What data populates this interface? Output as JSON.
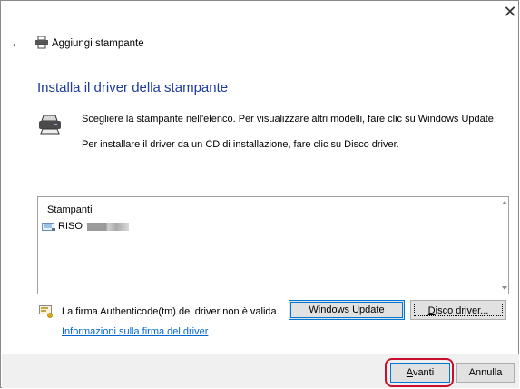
{
  "window": {
    "title": "Aggiungi stampante",
    "close_glyph": "✕",
    "back_glyph": "←"
  },
  "main": {
    "heading": "Installa il driver della stampante",
    "instruction_1": "Scegliere la stampante nell'elenco. Per visualizzare altri modelli, fare clic su Windows Update.",
    "instruction_2": "Per installare il driver da un CD di installazione, fare clic su Disco driver."
  },
  "printer_list": {
    "header": "Stampanti",
    "items": [
      {
        "label": "RISO"
      }
    ]
  },
  "signature": {
    "text": "La firma Authenticode(tm) del driver non è valida.",
    "link": "Informazioni sulla firma del driver"
  },
  "buttons": {
    "windows_update": {
      "prefix": "",
      "accel": "W",
      "rest": "indows Update"
    },
    "disk_driver": {
      "prefix": "",
      "accel": "D",
      "rest": "isco driver..."
    },
    "next": {
      "prefix": "",
      "accel": "A",
      "rest": "vanti"
    },
    "cancel": "Annulla"
  },
  "icons": {
    "back": "back-arrow-icon",
    "title_printer": "printer-icon",
    "header_printer": "printer-icon",
    "list_item": "printer-icon",
    "signature": "warning-icon"
  },
  "colors": {
    "heading": "#1f3b9c",
    "link": "#0066cc",
    "button_focus": "#0078d7",
    "highlight": "#c8102e",
    "footer": "#f0f0f0"
  }
}
